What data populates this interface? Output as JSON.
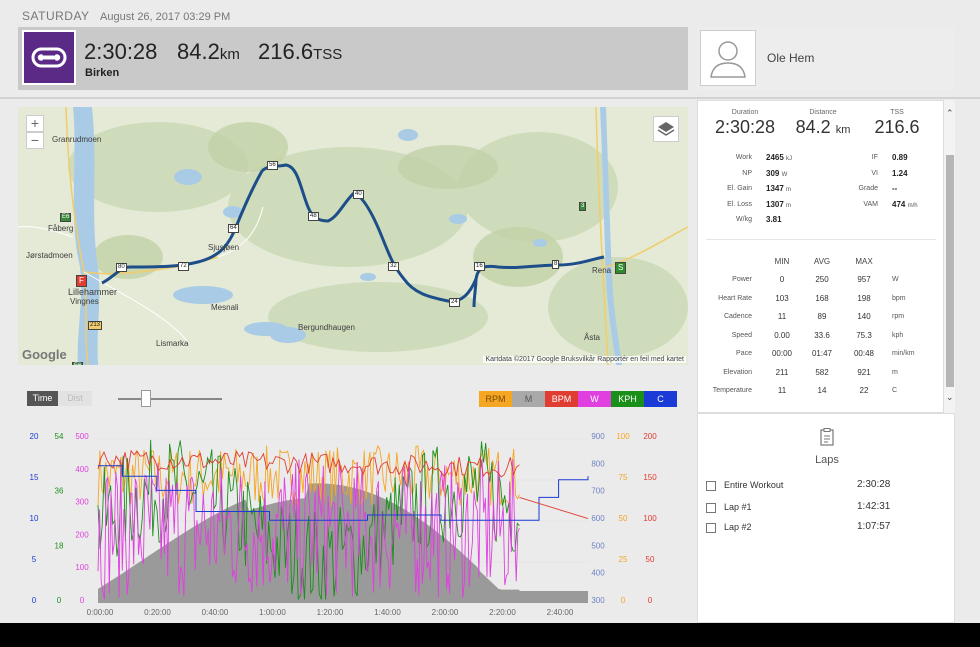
{
  "header": {
    "day": "SATURDAY",
    "datetime": "August 26, 2017 03:29 PM",
    "duration": "2:30:28",
    "distance_value": "84.2",
    "distance_unit": "km",
    "tss_value": "216.6",
    "tss_unit": "TSS",
    "workout_name": "Birken",
    "athlete_name": "Ole Hem",
    "workout_icon": "bike-chain-icon",
    "accent_color": "#5a2a86"
  },
  "map": {
    "zoom_in": "+",
    "zoom_out": "−",
    "layers_icon": "layers-icon",
    "logo": "Google",
    "attribution": "Kartdata ©2017 Google   Bruksvilkår   Rapportér en feil med kartet",
    "places": [
      "Granrudmoen",
      "Fåberg",
      "Jørstadmoen",
      "Lillehammer",
      "Vingnes",
      "Mesnali",
      "Bergundhaugen",
      "Lismarka",
      "Sjusjøen",
      "Rena",
      "Åsta"
    ],
    "road_labels": [
      "213",
      "E6",
      "E6",
      "3"
    ],
    "km_markers": [
      "80",
      "72",
      "64",
      "56",
      "48",
      "40",
      "32",
      "24",
      "16",
      "8"
    ],
    "start_marker": "S",
    "finish_marker": "F",
    "route_color": "#1d4e89"
  },
  "chart": {
    "toggle_time": "Time",
    "toggle_dist": "Dist",
    "channels": [
      {
        "label": "RPM",
        "color": "#f5a623"
      },
      {
        "label": "M",
        "color": "#a9a9a9"
      },
      {
        "label": "BPM",
        "color": "#e03c31"
      },
      {
        "label": "W",
        "color": "#e040e0"
      },
      {
        "label": "KPH",
        "color": "#1a8f1a"
      },
      {
        "label": "C",
        "color": "#1b3bd6"
      }
    ],
    "axis_c": [
      "20",
      "15",
      "10",
      "5",
      "0"
    ],
    "axis_kph": [
      "54",
      "36",
      "18",
      "0"
    ],
    "axis_w": [
      "500",
      "400",
      "300",
      "200",
      "100",
      "0"
    ],
    "axis_m": [
      "900",
      "800",
      "700",
      "600",
      "500",
      "400",
      "300"
    ],
    "axis_rpm": [
      "100",
      "75",
      "50",
      "25",
      "0"
    ],
    "axis_bpm": [
      "200",
      "150",
      "100",
      "50",
      "0"
    ],
    "x_ticks": [
      "0:00:00",
      "0:20:00",
      "0:40:00",
      "1:00:00",
      "1:20:00",
      "1:40:00",
      "2:00:00",
      "2:20:00",
      "2:40:00"
    ]
  },
  "summary_panel": {
    "duration_label": "Duration",
    "duration": "2:30:28",
    "distance_label": "Distance",
    "distance": "84.2",
    "distance_unit": "km",
    "tss_label": "TSS",
    "tss": "216.6",
    "left_stats": [
      {
        "label": "Work",
        "value": "2465",
        "unit": "kJ"
      },
      {
        "label": "NP",
        "value": "309",
        "unit": "W"
      },
      {
        "label": "El. Gain",
        "value": "1347",
        "unit": "m"
      },
      {
        "label": "El. Loss",
        "value": "1307",
        "unit": "m"
      },
      {
        "label": "W/kg",
        "value": "3.81",
        "unit": ""
      }
    ],
    "right_stats": [
      {
        "label": "IF",
        "value": "0.89",
        "unit": ""
      },
      {
        "label": "VI",
        "value": "1.24",
        "unit": ""
      },
      {
        "label": "Grade",
        "value": "--",
        "unit": ""
      },
      {
        "label": "VAM",
        "value": "474",
        "unit": "m/h"
      }
    ],
    "table_headers": [
      "MIN",
      "AVG",
      "MAX"
    ],
    "table_rows": [
      {
        "label": "Power",
        "min": "0",
        "avg": "250",
        "max": "957",
        "unit": "W"
      },
      {
        "label": "Heart Rate",
        "min": "103",
        "avg": "168",
        "max": "198",
        "unit": "bpm"
      },
      {
        "label": "Cadence",
        "min": "11",
        "avg": "89",
        "max": "140",
        "unit": "rpm"
      },
      {
        "label": "Speed",
        "min": "0.00",
        "avg": "33.6",
        "max": "75.3",
        "unit": "kph"
      },
      {
        "label": "Pace",
        "min": "00:00",
        "avg": "01:47",
        "max": "00:48",
        "unit": "min/km"
      },
      {
        "label": "Elevation",
        "min": "211",
        "avg": "582",
        "max": "921",
        "unit": "m"
      },
      {
        "label": "Temperature",
        "min": "11",
        "avg": "14",
        "max": "22",
        "unit": "C"
      }
    ]
  },
  "laps": {
    "title": "Laps",
    "icon": "clipboard-icon",
    "items": [
      {
        "name": "Entire Workout",
        "time": "2:30:28"
      },
      {
        "name": "Lap #1",
        "time": "1:42:31"
      },
      {
        "name": "Lap #2",
        "time": "1:07:57"
      }
    ]
  }
}
